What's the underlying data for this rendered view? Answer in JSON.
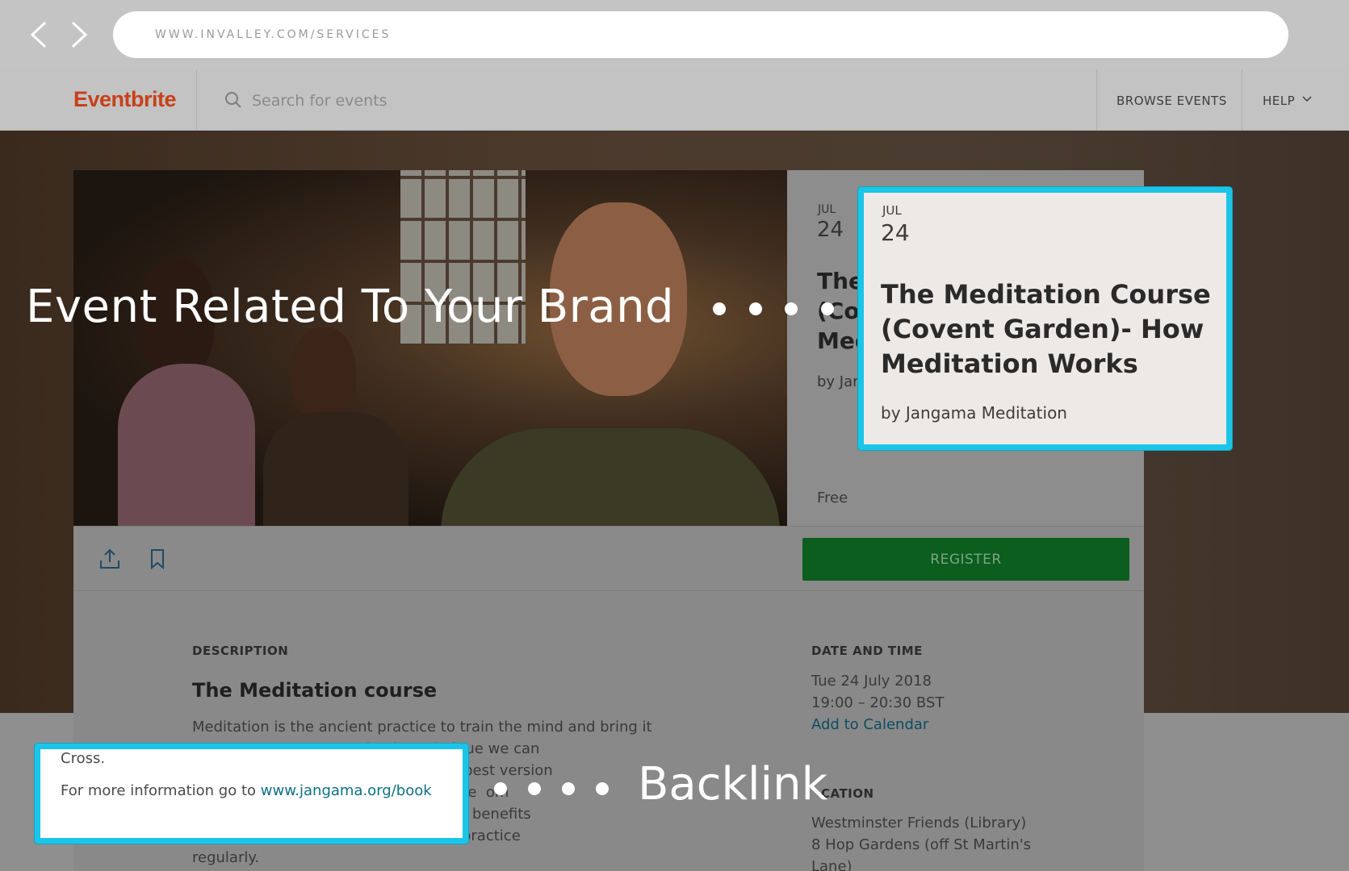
{
  "browser": {
    "url": "WWW.INVALLEY.COM/SERVICES",
    "back_icon": "chevron-left-icon",
    "forward_icon": "chevron-right-icon"
  },
  "header": {
    "logo": "Eventbrite",
    "search_placeholder": "Search for events",
    "browse_events": "BROWSE EVENTS",
    "help": "HELP"
  },
  "event": {
    "month": "JUL",
    "day": "24",
    "title_visible": "The (Co Med",
    "by_visible": "by Jan",
    "price": "Free",
    "register_label": "REGISTER",
    "share_icon": "share-upload-icon",
    "bookmark_icon": "bookmark-icon"
  },
  "description": {
    "label": "DESCRIPTION",
    "title": "The Meditation course",
    "lines": [
      "Meditation is the ancient practice to train the mind and bring it",
      "                                    simple technique we can",
      "                                    d become the best version",
      "                                    tal f cus  nd  ree  om",
      "                                    of the amazing benefits",
      "                                    echnique and practice",
      "regularly."
    ]
  },
  "date_time": {
    "label": "DATE AND TIME",
    "date": "Tue 24 July 2018",
    "time": "19:00 – 20:30 BST",
    "add_to_calendar": "Add to Calendar"
  },
  "location": {
    "label": "CATION",
    "line1": "Westminster Friends (Library)",
    "line2": "8 Hop Gardens (off St Martin's",
    "line3": "Lane)"
  },
  "callout_event": {
    "month": "JUL",
    "day": "24",
    "title": "The Meditation Course (Covent Garden)- How Meditation Works",
    "by": "by Jangama Meditation"
  },
  "callout_link": {
    "cross": "Cross.",
    "more_prefix": "For more information go to ",
    "link": "www.jangama.org/book"
  },
  "annotations": {
    "event_related": "Event Related To Your Brand",
    "backlink": "Backlink"
  },
  "colors": {
    "accent_cyan": "#1bc5e8",
    "brand_orange": "#c8401a",
    "register_green": "#0b5e1d",
    "link_teal": "#0e6f86"
  }
}
